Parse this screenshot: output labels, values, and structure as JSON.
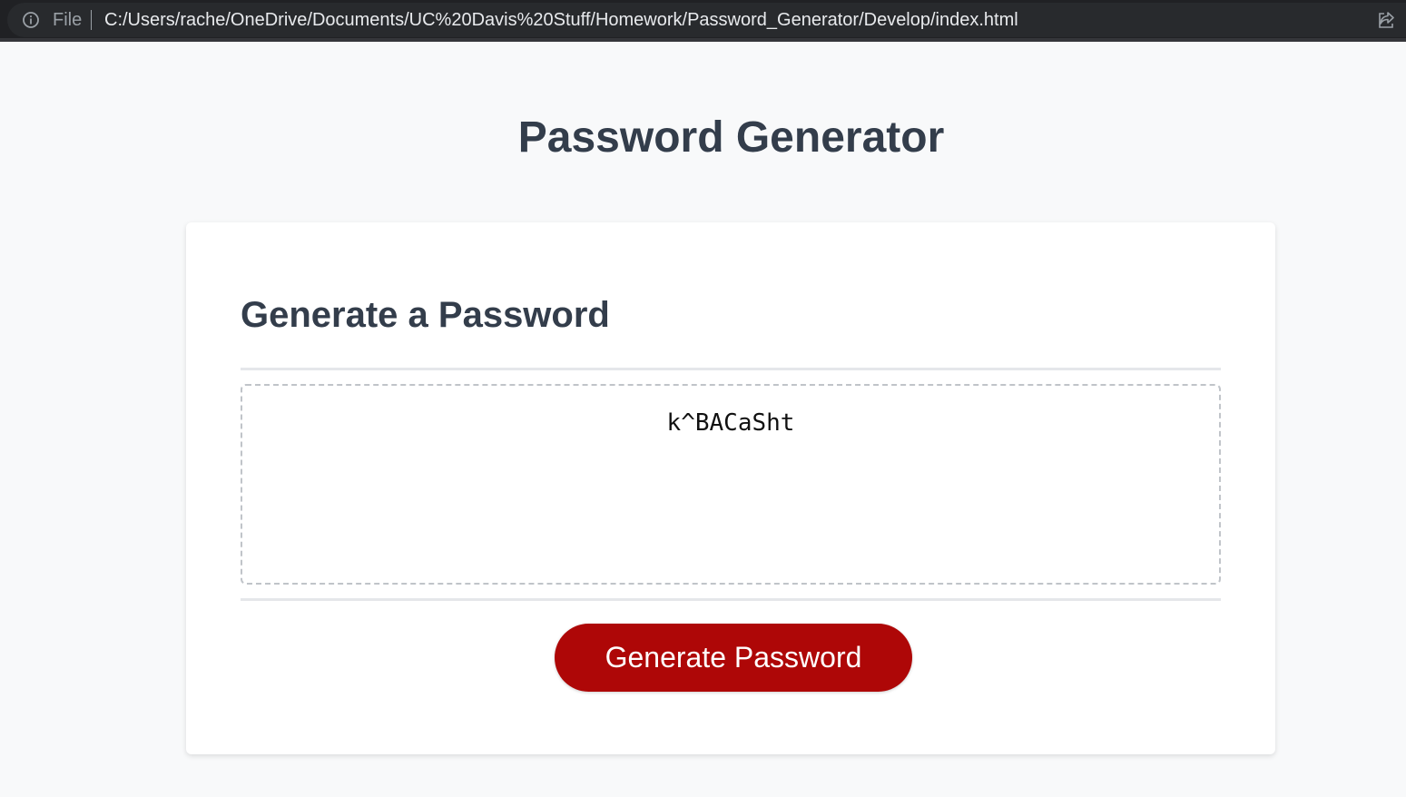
{
  "browser": {
    "scheme_label": "File",
    "url": "C:/Users/rache/OneDrive/Documents/UC%20Davis%20Stuff/Homework/Password_Generator/Develop/index.html",
    "icons": {
      "info": "info-icon",
      "share": "share-icon"
    }
  },
  "page": {
    "title": "Password Generator"
  },
  "card": {
    "header": "Generate a Password",
    "password_value": "k^BACaSht",
    "generate_button_label": "Generate Password"
  },
  "colors": {
    "page_background": "#f8f9fa",
    "heading": "#333d4b",
    "button": "#ae0707",
    "button_text": "#ffffff"
  }
}
